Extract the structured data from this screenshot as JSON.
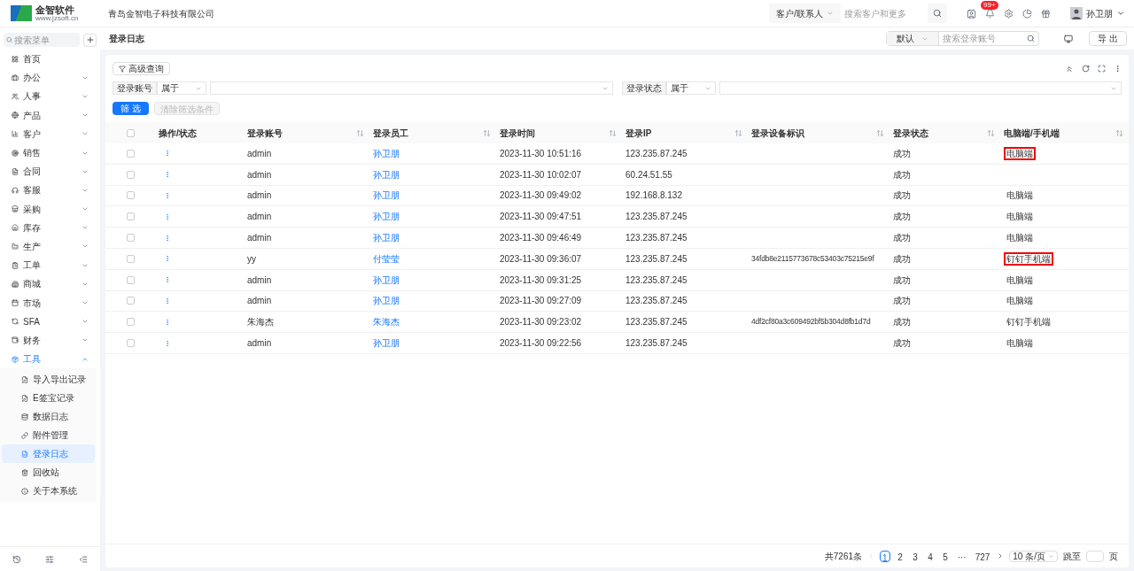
{
  "header": {
    "logo_name": "金智软件",
    "logo_url": "www.jzsoft.cn",
    "company": "青岛金智电子科技有限公司",
    "search_scope": "客户/联系人",
    "search_placeholder": "搜索客户和更多",
    "notification_badge": "99+",
    "user_name": "孙卫朋"
  },
  "sidebar": {
    "search_placeholder": "搜索菜单",
    "items": [
      {
        "label": "首页",
        "kind": "link"
      },
      {
        "label": "办公",
        "kind": "group",
        "expanded": false
      },
      {
        "label": "人事",
        "kind": "group",
        "expanded": false
      },
      {
        "label": "产品",
        "kind": "group",
        "expanded": false
      },
      {
        "label": "客户",
        "kind": "group",
        "expanded": false
      },
      {
        "label": "销售",
        "kind": "group",
        "expanded": false
      },
      {
        "label": "合同",
        "kind": "group",
        "expanded": false
      },
      {
        "label": "客服",
        "kind": "group",
        "expanded": false
      },
      {
        "label": "采购",
        "kind": "group",
        "expanded": false
      },
      {
        "label": "库存",
        "kind": "group",
        "expanded": false
      },
      {
        "label": "生产",
        "kind": "group",
        "expanded": false
      },
      {
        "label": "工单",
        "kind": "group",
        "expanded": false
      },
      {
        "label": "商城",
        "kind": "group",
        "expanded": false
      },
      {
        "label": "市场",
        "kind": "group",
        "expanded": false
      },
      {
        "label": "SFA",
        "kind": "group",
        "expanded": false
      },
      {
        "label": "财务",
        "kind": "group",
        "expanded": false
      },
      {
        "label": "工具",
        "kind": "group",
        "expanded": true,
        "children": [
          {
            "label": "导入导出记录",
            "selected": false
          },
          {
            "label": "E签宝记录",
            "selected": false
          },
          {
            "label": "数据日志",
            "selected": false
          },
          {
            "label": "附件管理",
            "selected": false
          },
          {
            "label": "登录日志",
            "selected": true
          },
          {
            "label": "回收站",
            "selected": false
          },
          {
            "label": "关于本系统",
            "selected": false
          }
        ]
      }
    ]
  },
  "page": {
    "title": "登录日志",
    "view": "默认",
    "search_placeholder": "搜索登录账号",
    "export": "导 出"
  },
  "filters": {
    "advanced": "高级查询",
    "conditions": [
      {
        "field": "登录账号",
        "operator": "属于"
      },
      {
        "field": "登录状态",
        "operator": "属于"
      }
    ],
    "apply": "筛 选",
    "clear": "清除筛选条件",
    "clear_disabled": true
  },
  "table": {
    "select_all_checked": false,
    "columns": [
      "操作/状态",
      "登录账号",
      "登录员工",
      "登录时间",
      "登录IP",
      "登录设备标识",
      "登录状态",
      "电脑端/手机端"
    ],
    "rows": [
      {
        "checked": false,
        "account": "admin",
        "employee": "孙卫朋",
        "time": "2023-11-30 10:51:16",
        "ip": "123.235.87.245",
        "status": "成功",
        "client": "电脑端",
        "client_highlighted": true
      },
      {
        "checked": false,
        "account": "admin",
        "employee": "孙卫朋",
        "time": "2023-11-30 10:02:07",
        "ip": "60.24.51.55",
        "status": "成功"
      },
      {
        "checked": false,
        "account": "admin",
        "employee": "孙卫朋",
        "time": "2023-11-30 09:49:02",
        "ip": "192.168.8.132",
        "status": "成功",
        "client": "电脑端",
        "client_highlighted": false
      },
      {
        "checked": false,
        "account": "admin",
        "employee": "孙卫朋",
        "time": "2023-11-30 09:47:51",
        "ip": "123.235.87.245",
        "status": "成功",
        "client": "电脑端",
        "client_highlighted": false
      },
      {
        "checked": false,
        "account": "admin",
        "employee": "孙卫朋",
        "time": "2023-11-30 09:46:49",
        "ip": "123.235.87.245",
        "status": "成功",
        "client": "电脑端",
        "client_highlighted": false
      },
      {
        "checked": false,
        "account": "yy",
        "employee": "付莹莹",
        "time": "2023-11-30 09:36:07",
        "ip": "123.235.87.245",
        "device_id": "34fdb8e2115773678c53403c75215e9f",
        "status": "成功",
        "client": "钉钉手机端",
        "client_highlighted": true
      },
      {
        "checked": false,
        "account": "admin",
        "employee": "孙卫朋",
        "time": "2023-11-30 09:31:25",
        "ip": "123.235.87.245",
        "status": "成功",
        "client": "电脑端",
        "client_highlighted": false
      },
      {
        "checked": false,
        "account": "admin",
        "employee": "孙卫朋",
        "time": "2023-11-30 09:27:09",
        "ip": "123.235.87.245",
        "status": "成功",
        "client": "电脑端",
        "client_highlighted": false
      },
      {
        "checked": false,
        "account": "朱海杰",
        "employee": "朱海杰",
        "time": "2023-11-30 09:23:02",
        "ip": "123.235.87.245",
        "device_id": "4df2cf80a3c609492bf5b304d8fb1d7d",
        "status": "成功",
        "client": "钉钉手机端",
        "client_highlighted": false
      },
      {
        "checked": false,
        "account": "admin",
        "employee": "孙卫朋",
        "time": "2023-11-30 09:22:56",
        "ip": "123.235.87.245",
        "status": "成功",
        "client": "电脑端",
        "client_highlighted": false
      }
    ]
  },
  "pagination": {
    "total": "共7261条",
    "pages": [
      {
        "label": "1",
        "selected": true
      },
      {
        "label": "2",
        "selected": false
      },
      {
        "label": "3",
        "selected": false
      },
      {
        "label": "4",
        "selected": false
      },
      {
        "label": "5",
        "selected": false
      },
      {
        "label": "···",
        "selected": false
      },
      {
        "label": "727",
        "selected": false
      }
    ],
    "page_size": "10 条/页",
    "jump_label": "跳至",
    "page_unit": "页"
  }
}
